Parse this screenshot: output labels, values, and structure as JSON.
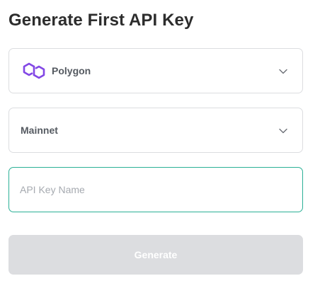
{
  "page": {
    "title": "Generate First API Key"
  },
  "network_select": {
    "selected": "Polygon",
    "icon": "polygon-logo-icon",
    "icon_color": "#8247e5"
  },
  "environment_select": {
    "selected": "Mainnet"
  },
  "api_key_name": {
    "value": "",
    "placeholder": "API Key Name",
    "focus_border_color": "#2bb096"
  },
  "generate_button": {
    "label": "Generate",
    "disabled": true,
    "background": "#dcdde0"
  }
}
